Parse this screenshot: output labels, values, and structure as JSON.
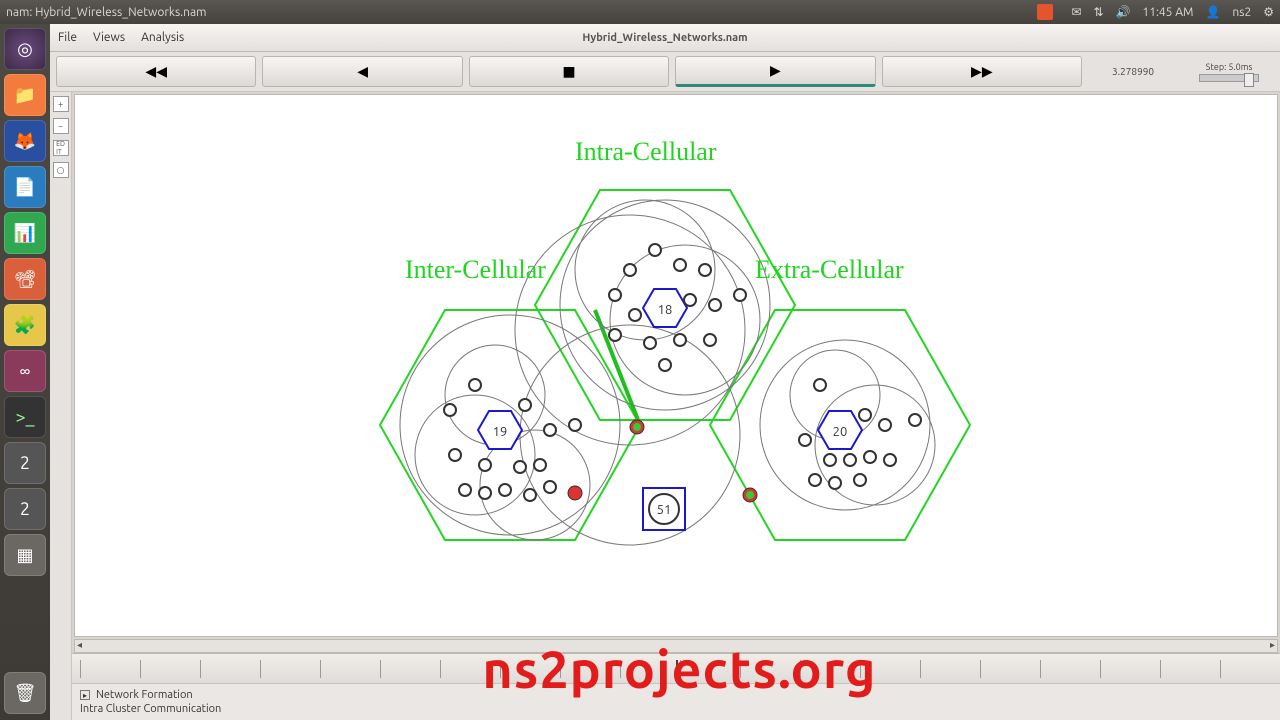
{
  "system": {
    "window_title": "nam: Hybrid_Wireless_Networks.nam",
    "clock": "11:45 AM",
    "user": "ns2",
    "tray_icons": [
      "mail-icon",
      "network-icon",
      "volume-icon",
      "clock",
      "user"
    ]
  },
  "launcher": [
    "dash",
    "files",
    "firefox",
    "writer",
    "calc",
    "impress",
    "software",
    "update",
    "terminal",
    "app1",
    "app2",
    "workspace",
    "trash"
  ],
  "menubar": {
    "file": "File",
    "views": "Views",
    "analysis": "Analysis",
    "doc_title": "Hybrid_Wireless_Networks.nam"
  },
  "playback": {
    "rewind": "◀◀",
    "back": "◀",
    "stop": "■",
    "play": "▶",
    "forward": "▶▶",
    "time_value": "3.278990",
    "step_label": "Step: 5.0ms"
  },
  "sim_labels": {
    "intra": "Intra-Cellular",
    "inter": "Inter-Cellular",
    "extra": "Extra-Cellular"
  },
  "base_stations": {
    "top": "18",
    "left": "19",
    "right": "20",
    "sink": "51"
  },
  "status": {
    "row1": "Network Formation",
    "row2": "Intra Cluster Communication"
  },
  "watermark": "ns2projects.org"
}
